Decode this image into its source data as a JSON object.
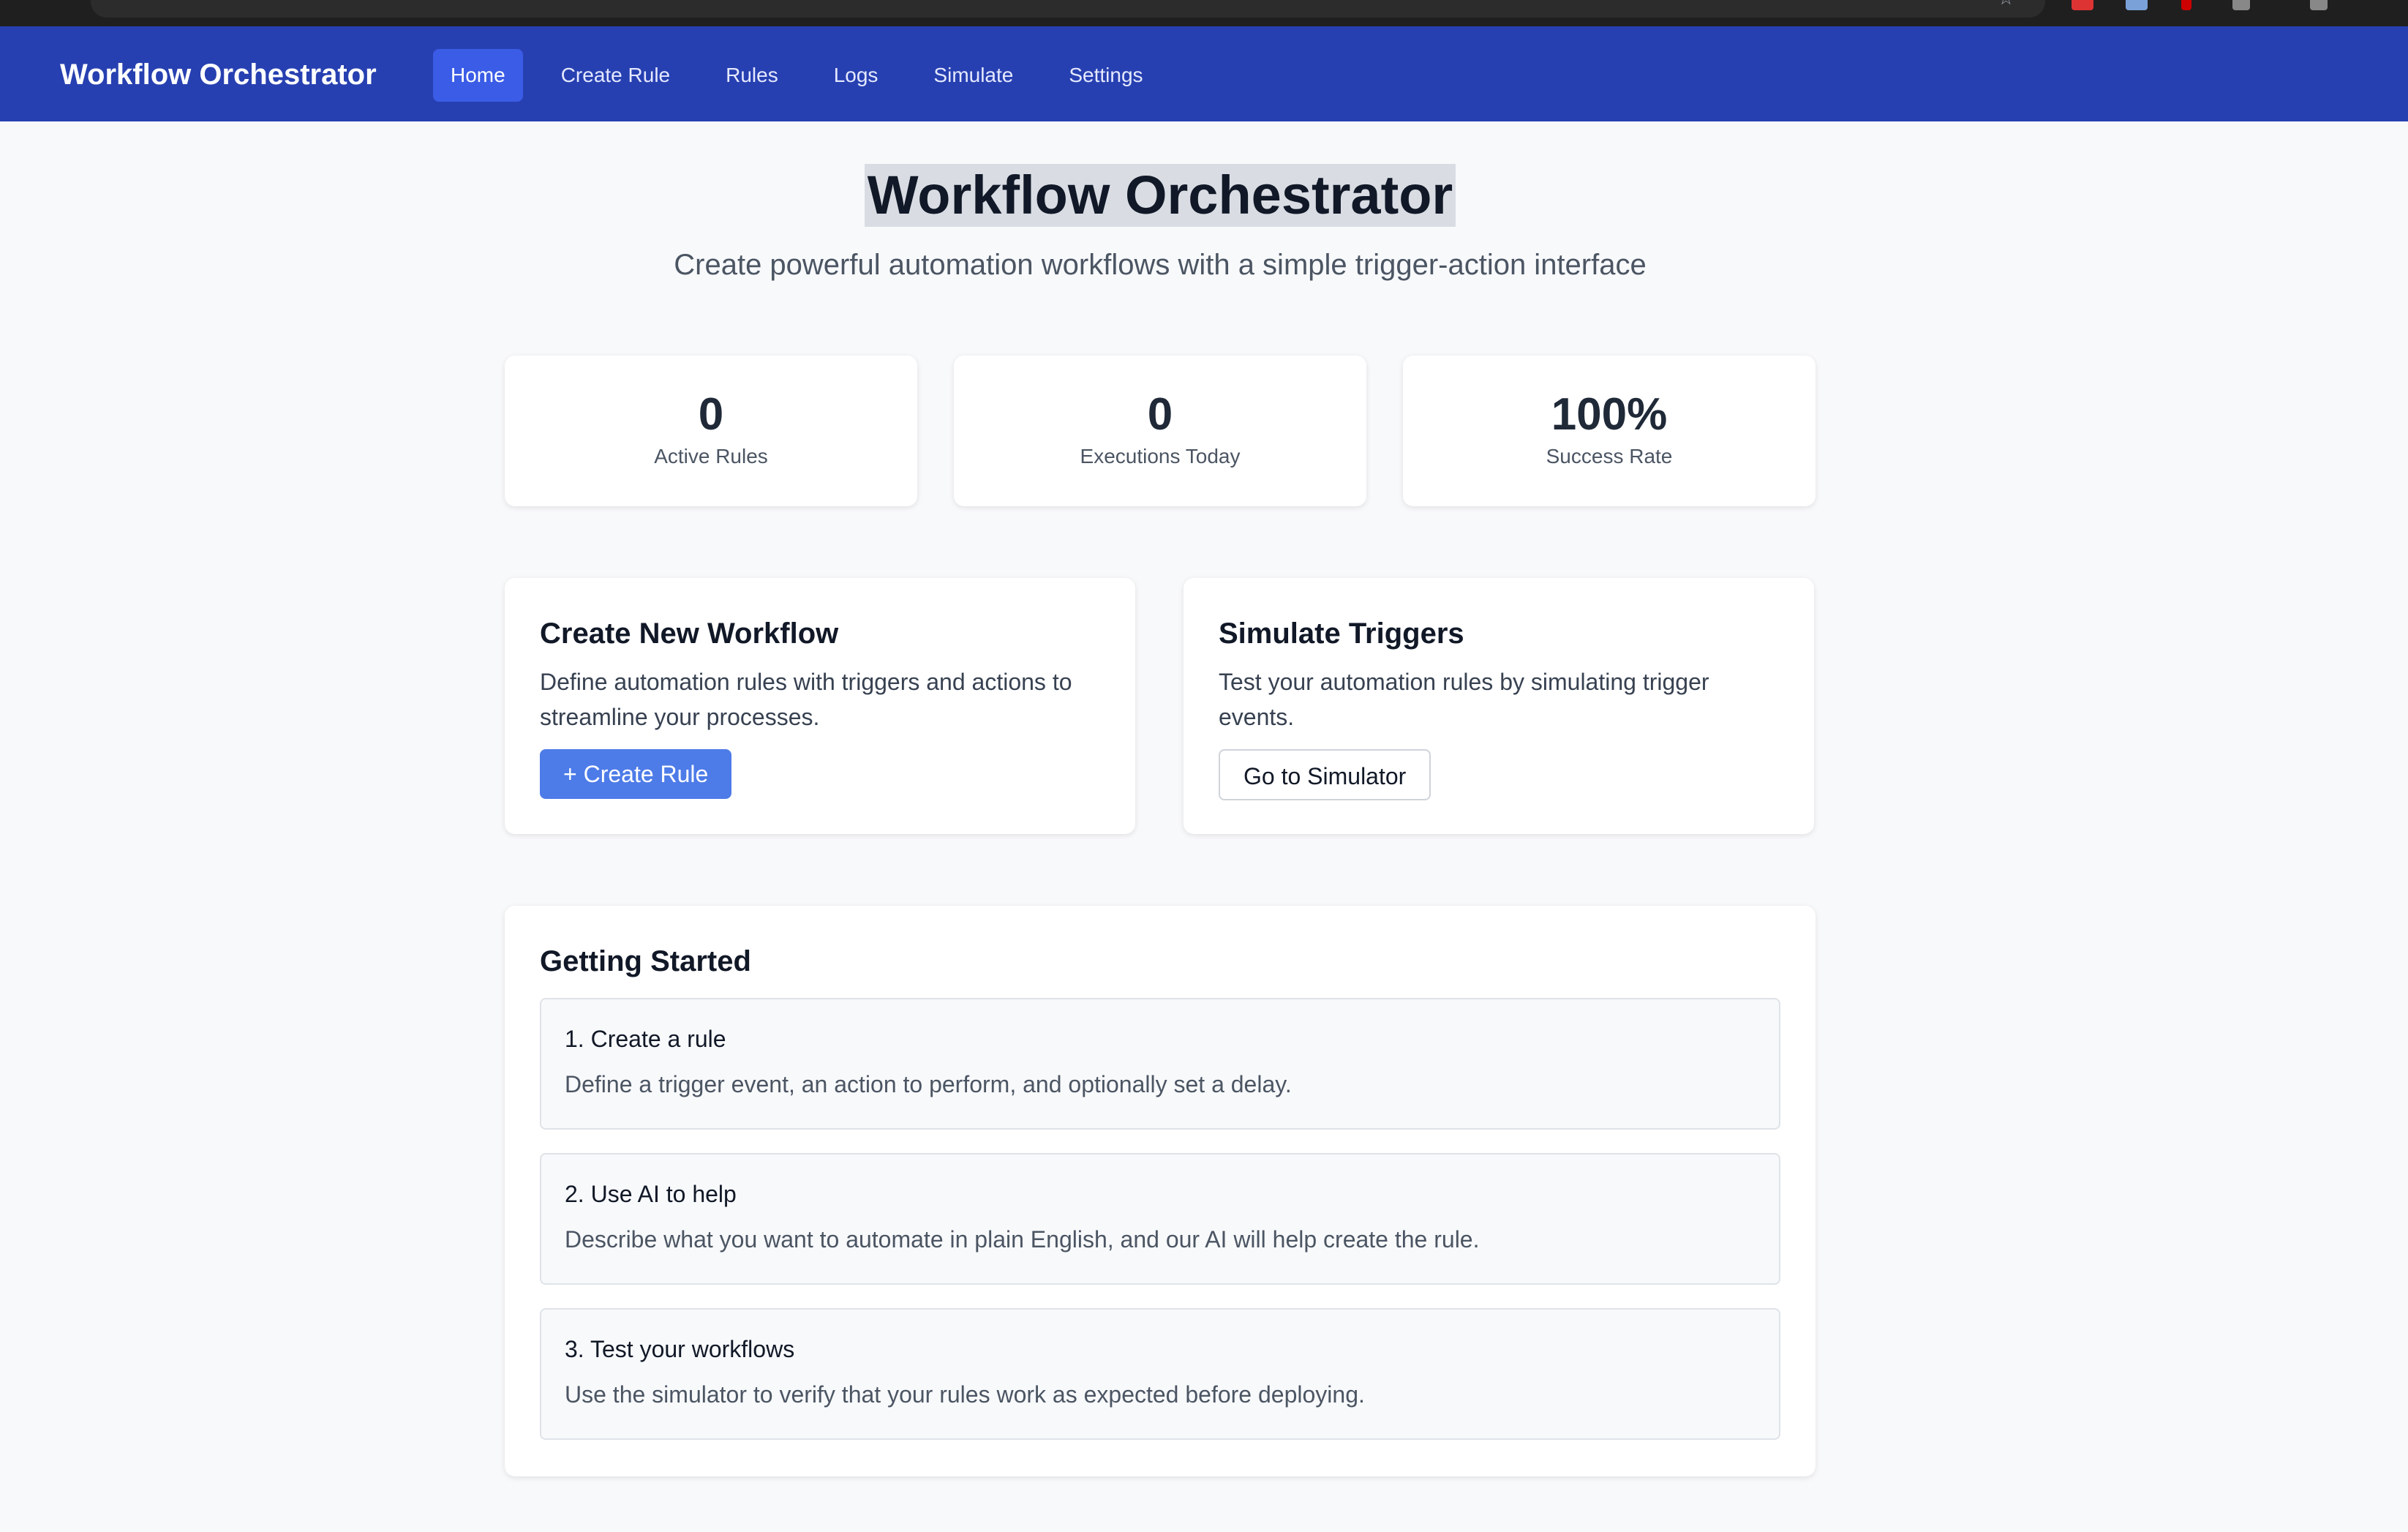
{
  "app": {
    "brand": "Workflow Orchestrator"
  },
  "nav": {
    "items": [
      {
        "label": "Home",
        "active": true
      },
      {
        "label": "Create Rule",
        "active": false
      },
      {
        "label": "Rules",
        "active": false
      },
      {
        "label": "Logs",
        "active": false
      },
      {
        "label": "Simulate",
        "active": false
      },
      {
        "label": "Settings",
        "active": false
      }
    ]
  },
  "hero": {
    "title": "Workflow Orchestrator",
    "subtitle": "Create powerful automation workflows with a simple trigger-action interface"
  },
  "stats": [
    {
      "value": "0",
      "label": "Active Rules"
    },
    {
      "value": "0",
      "label": "Executions Today"
    },
    {
      "value": "100%",
      "label": "Success Rate"
    }
  ],
  "cards": {
    "create": {
      "title": "Create New Workflow",
      "description": "Define automation rules with triggers and actions to streamline your processes.",
      "button": "+ Create Rule"
    },
    "simulate": {
      "title": "Simulate Triggers",
      "description": "Test your automation rules by simulating trigger events.",
      "button": "Go to Simulator"
    }
  },
  "getting_started": {
    "title": "Getting Started",
    "steps": [
      {
        "title": "1. Create a rule",
        "description": "Define a trigger event, an action to perform, and optionally set a delay."
      },
      {
        "title": "2. Use AI to help",
        "description": "Describe what you want to automate in plain English, and our AI will help create the rule."
      },
      {
        "title": "3. Test your workflows",
        "description": "Use the simulator to verify that your rules work as expected before deploying."
      }
    ]
  },
  "theme": {
    "nav_bg": "#2740b1",
    "nav_active": "#3b5ce6",
    "primary_button": "#4d7be8",
    "page_bg": "#f8f9fb"
  }
}
